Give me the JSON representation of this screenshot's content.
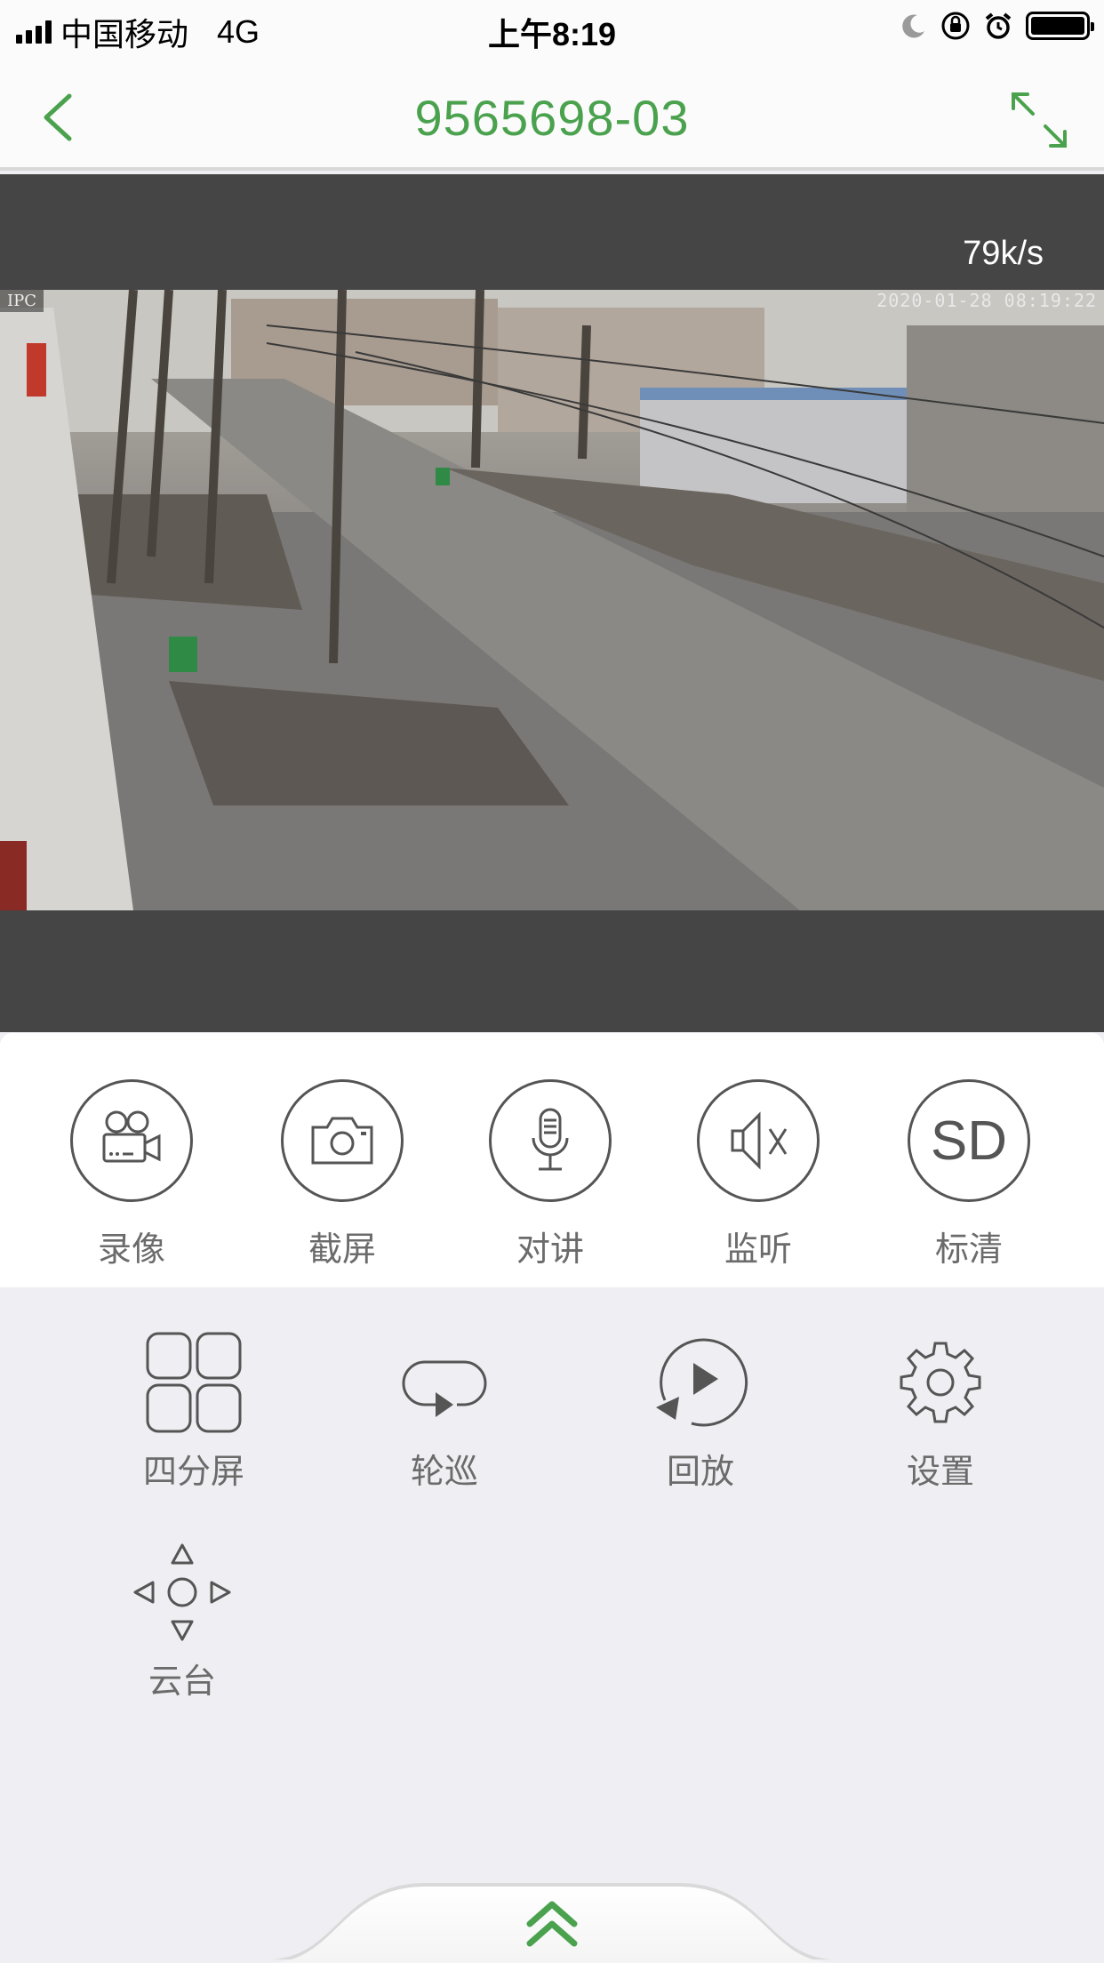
{
  "status_bar": {
    "carrier": "中国移动",
    "network": "4G",
    "time": "上午8:19"
  },
  "nav": {
    "title": "9565698-03"
  },
  "video": {
    "speed": "79k/s",
    "osd_label": "IPC",
    "osd_timestamp": "2020-01-28 08:19:22"
  },
  "controls": [
    {
      "label": "录像",
      "icon": "video-camera-icon"
    },
    {
      "label": "截屏",
      "icon": "camera-icon"
    },
    {
      "label": "对讲",
      "icon": "microphone-icon"
    },
    {
      "label": "监听",
      "icon": "speaker-mute-icon"
    },
    {
      "label": "标清",
      "icon": "sd-icon",
      "icon_text": "SD"
    }
  ],
  "tools": [
    {
      "label": "四分屏",
      "icon": "quad-screen-icon"
    },
    {
      "label": "轮巡",
      "icon": "loop-icon"
    },
    {
      "label": "回放",
      "icon": "playback-icon"
    },
    {
      "label": "设置",
      "icon": "gear-icon"
    },
    {
      "label": "云台",
      "icon": "ptz-icon"
    }
  ],
  "colors": {
    "accent": "#4ba24e",
    "video_bg": "#454545",
    "panel_bg": "#ffffff",
    "tools_bg": "#efeff3",
    "icon_stroke": "#555555"
  }
}
